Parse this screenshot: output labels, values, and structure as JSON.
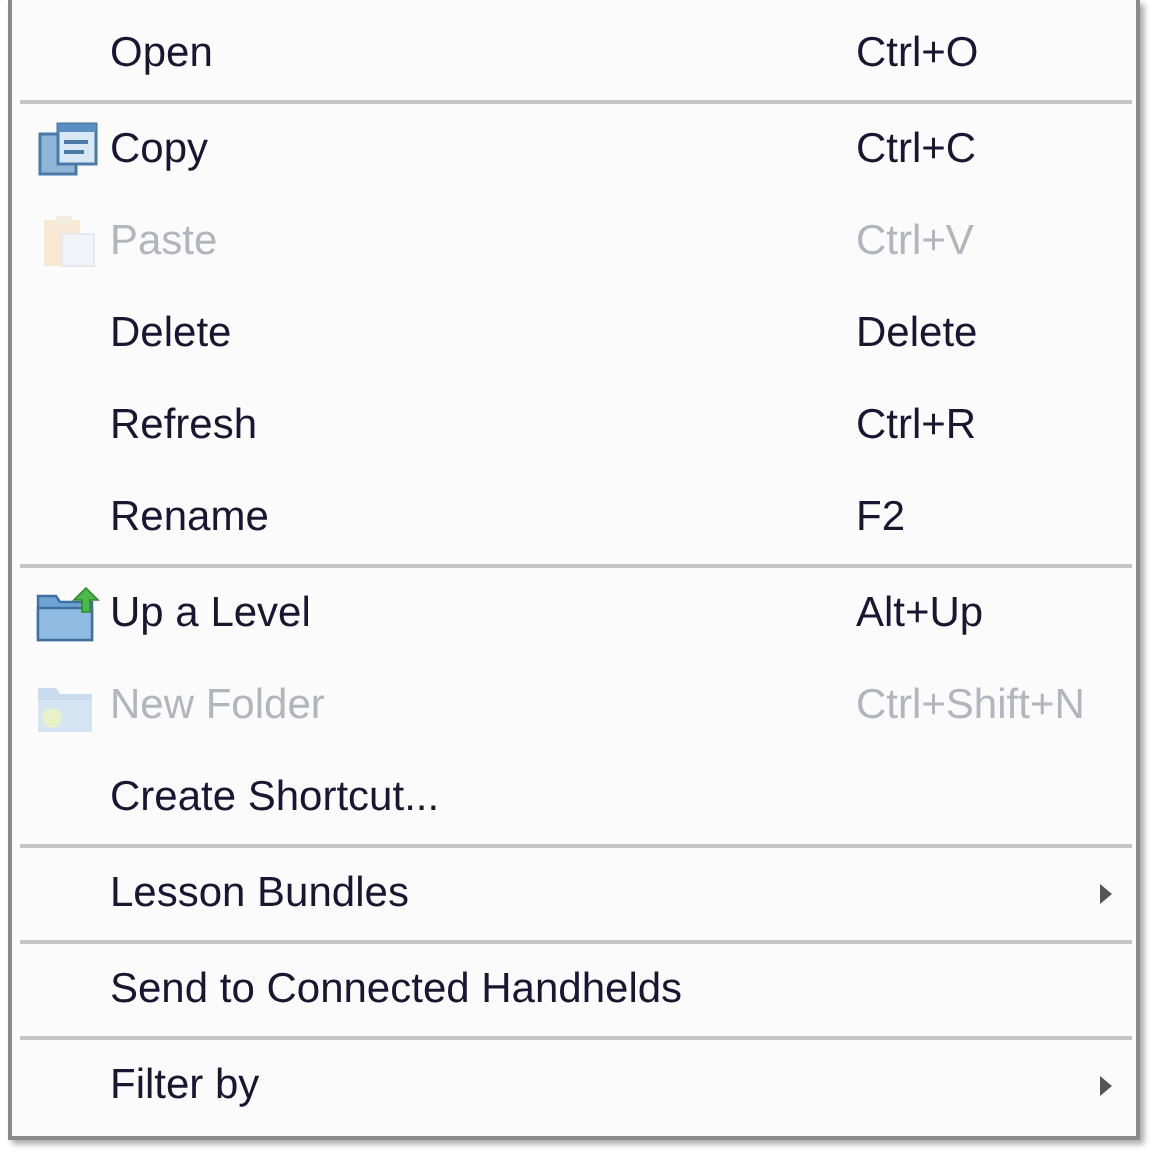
{
  "menu": {
    "groups": [
      {
        "items": [
          {
            "label": "Open",
            "shortcut": "Ctrl+O",
            "disabled": false
          }
        ]
      },
      {
        "items": [
          {
            "label": "Copy",
            "shortcut": "Ctrl+C",
            "disabled": false,
            "kind": "copy"
          },
          {
            "label": "Paste",
            "shortcut": "Ctrl+V",
            "disabled": true,
            "kind": "paste"
          },
          {
            "label": "Delete",
            "shortcut": "Delete",
            "disabled": false
          },
          {
            "label": "Refresh",
            "shortcut": "Ctrl+R",
            "disabled": false
          },
          {
            "label": "Rename",
            "shortcut": "F2",
            "disabled": false
          }
        ]
      },
      {
        "items": [
          {
            "label": "Up a Level",
            "shortcut": "Alt+Up",
            "disabled": false,
            "kind": "up"
          },
          {
            "label": "New Folder",
            "shortcut": "Ctrl+Shift+N",
            "disabled": true,
            "kind": "folder"
          },
          {
            "label": "Create Shortcut...",
            "disabled": false
          }
        ]
      },
      {
        "items": [
          {
            "label": "Lesson Bundles",
            "disabled": false,
            "submenu": true
          }
        ]
      },
      {
        "items": [
          {
            "label": "Send to Connected Handhelds",
            "disabled": false
          }
        ]
      },
      {
        "items": [
          {
            "label": "Filter by",
            "disabled": false,
            "submenu": true
          }
        ]
      }
    ]
  }
}
